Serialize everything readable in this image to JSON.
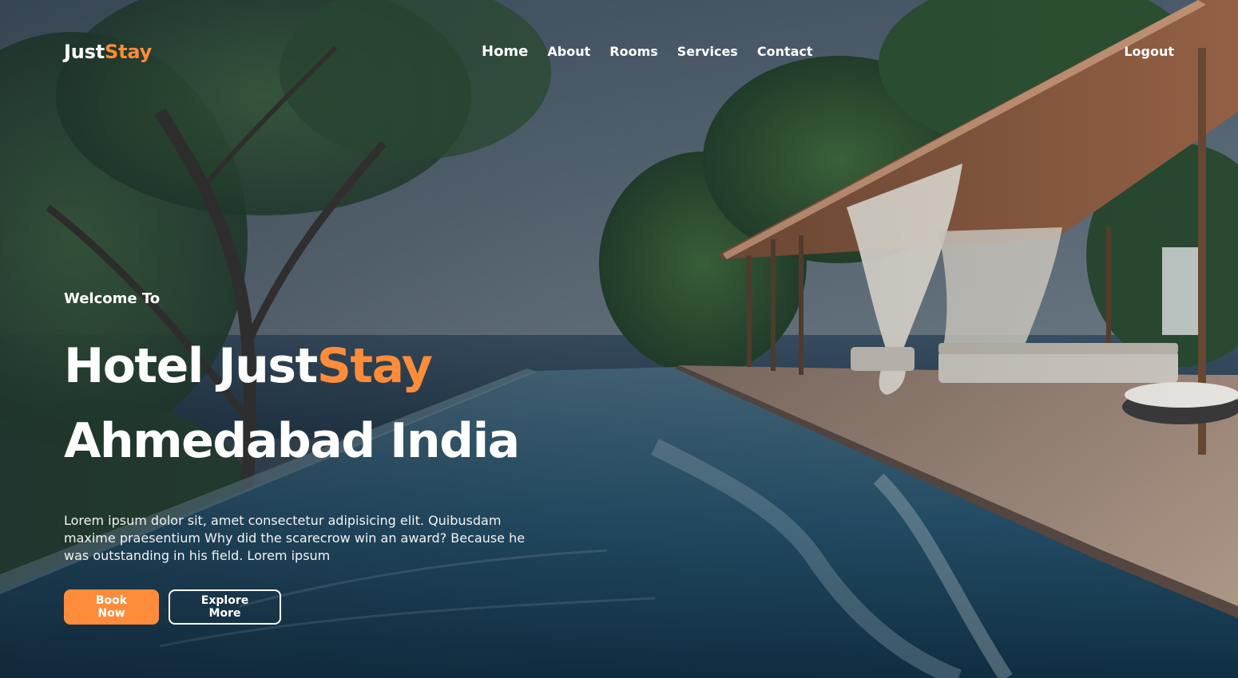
{
  "brand": {
    "name_part1": "Just",
    "name_part2": "Stay",
    "accent_color": "#ff8c3a"
  },
  "nav": {
    "items": [
      {
        "label": "Home"
      },
      {
        "label": "About"
      },
      {
        "label": "Rooms"
      },
      {
        "label": "Services"
      },
      {
        "label": "Contact"
      }
    ],
    "logout_label": "Logout"
  },
  "hero": {
    "welcome": "Welcome To",
    "headline_prefix": "Hotel Just",
    "headline_accent": "Stay",
    "headline_line2": "Ahmedabad India",
    "description": "Lorem ipsum dolor sit, amet consectetur adipisicing elit. Quibusdam maxime praesentium Why did the scarecrow win an award? Because he was outstanding in his field. Lorem ipsum",
    "primary_button": "Book Now",
    "secondary_button": "Explore More"
  }
}
